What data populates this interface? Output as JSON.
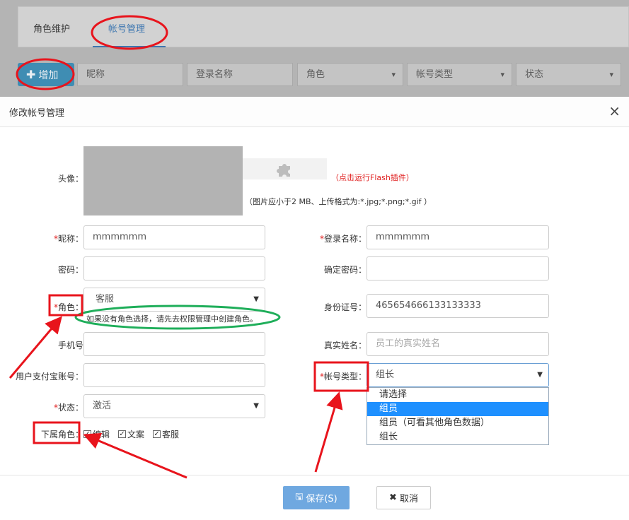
{
  "tabs": {
    "roles": "角色维护",
    "accounts": "帐号管理"
  },
  "toolbar": {
    "add_label": "增加",
    "nickname_placeholder": "昵称",
    "login_placeholder": "登录名称",
    "role_placeholder": "角色",
    "account_type_placeholder": "帐号类型",
    "status_placeholder": "状态"
  },
  "modal": {
    "title": "修改帐号管理",
    "close": "×",
    "avatar_label": "头像：",
    "flash_hint": "（点击运行Flash插件）",
    "upload_hint": "（图片应小于2 MB、上传格式为:*.jpg;*.png;*.gif ）",
    "nickname": {
      "label": "昵称：",
      "value": "mmmmmm"
    },
    "login_name": {
      "label": "登录名称：",
      "value": "mmmmmm"
    },
    "password": {
      "label": "密码：",
      "value": ""
    },
    "confirm_password": {
      "label": "确定密码：",
      "value": ""
    },
    "role": {
      "label": "角色：",
      "value": "客服",
      "hint": "如果没有角色选择，请先去权限管理中创建角色。"
    },
    "id_number": {
      "label": "身份证号：",
      "value": "465654666133133333"
    },
    "phone": {
      "label": "手机号：",
      "value": ""
    },
    "real_name": {
      "label": "真实姓名：",
      "placeholder": "员工的真实姓名"
    },
    "alipay": {
      "label": "用户支付宝账号：",
      "value": ""
    },
    "account_type": {
      "label": "帐号类型：",
      "value": "组长",
      "options": [
        "请选择",
        "组员",
        "组员（可看其他角色数据）",
        "组长"
      ],
      "highlighted": "组员"
    },
    "status": {
      "label": "状态：",
      "value": "激活"
    },
    "sub_roles": {
      "label": "下属角色：",
      "items": [
        "编辑",
        "文案",
        "客服"
      ]
    },
    "required_mark": "*",
    "save_label": "保存(S)",
    "cancel_label": "取消"
  },
  "colors": {
    "primary": "#3d76b0",
    "required": "#e02020",
    "save_button": "#6fa8e0",
    "highlight": "#1e90ff",
    "annotation_red": "#e8141c",
    "annotation_green": "#1fae5a"
  }
}
